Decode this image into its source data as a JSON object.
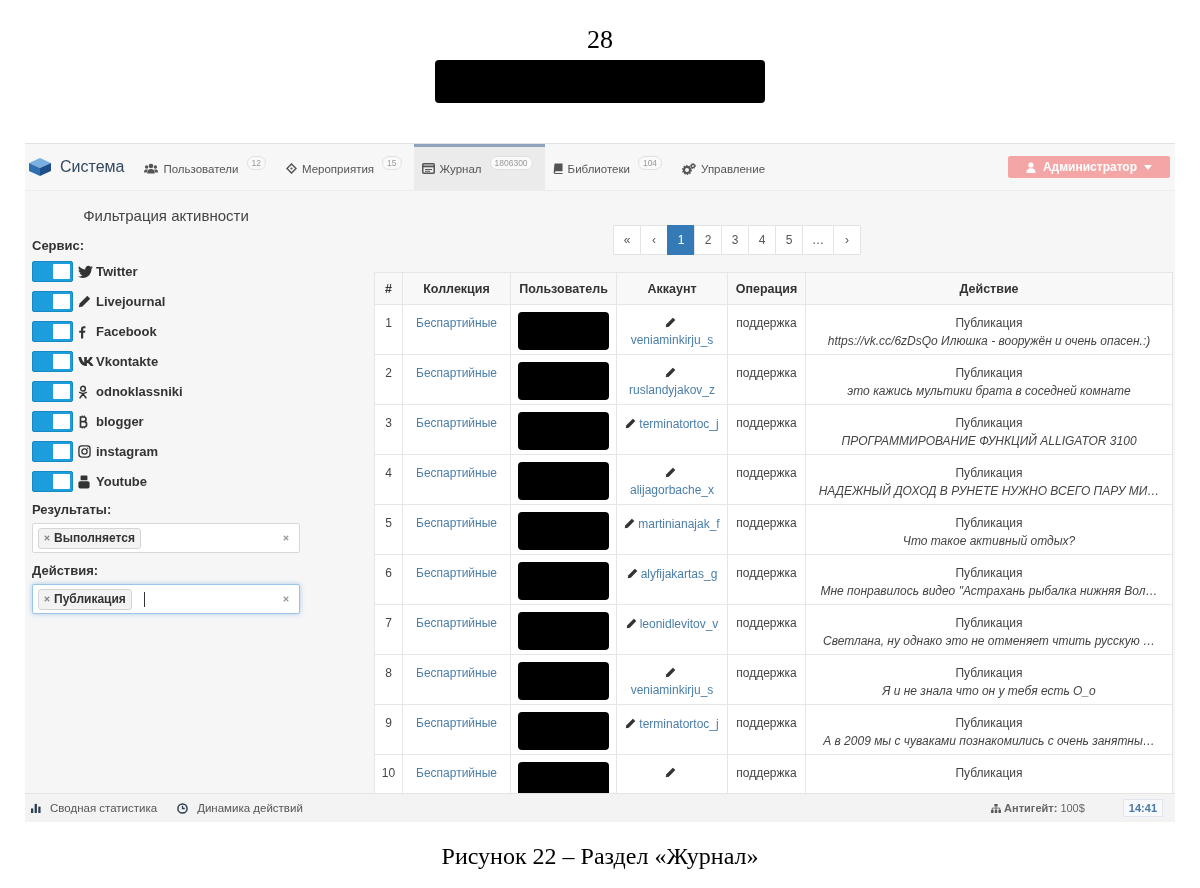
{
  "document": {
    "page_number": "28",
    "caption": "Рисунок 22 – Раздел «Журнал»"
  },
  "navbar": {
    "brand": "Система",
    "tabs": [
      {
        "label": "Пользователи",
        "count": "12",
        "selected": false
      },
      {
        "label": "Мероприятия",
        "count": "15",
        "selected": false
      },
      {
        "label": "Журнал",
        "count": "1806300",
        "selected": true
      },
      {
        "label": "Библиотеки",
        "count": "104",
        "selected": false
      },
      {
        "label": "Управление",
        "selected": false
      }
    ],
    "user_menu": "Администратор"
  },
  "sidebar": {
    "title": "Фильтрация активности",
    "services_label": "Сервис:",
    "services": [
      {
        "name": "Twitter",
        "on": true
      },
      {
        "name": "Livejournal",
        "on": true
      },
      {
        "name": "Facebook",
        "on": true
      },
      {
        "name": "Vkontakte",
        "on": true
      },
      {
        "name": "odnoklassniki",
        "on": true
      },
      {
        "name": "blogger",
        "on": true
      },
      {
        "name": "instagram",
        "on": true
      },
      {
        "name": "Youtube",
        "on": true
      }
    ],
    "filters": [
      {
        "label": "Результаты:",
        "tags": [
          "Выполняется"
        ],
        "focused": false
      },
      {
        "label": "Действия:",
        "tags": [
          "Публикация"
        ],
        "focused": true
      }
    ]
  },
  "pagination": [
    {
      "label": "«",
      "selected": false
    },
    {
      "label": "‹",
      "selected": false
    },
    {
      "label": "1",
      "selected": true
    },
    {
      "label": "2",
      "selected": false
    },
    {
      "label": "3",
      "selected": false
    },
    {
      "label": "4",
      "selected": false
    },
    {
      "label": "5",
      "selected": false
    },
    {
      "label": "…",
      "selected": false
    },
    {
      "label": "›",
      "selected": false
    }
  ],
  "table": {
    "columns": [
      "#",
      "Коллекция",
      "Пользователь",
      "Аккаунт",
      "Операция",
      "Действие"
    ],
    "rows": [
      {
        "number": "1",
        "collection": "Беспартийные",
        "account": "veniaminkirju_s",
        "operation": "поддержка",
        "action": "Публикация",
        "text": "https://vk.cc/6zDsQo Илюшка - вооружён и очень опасен.:)"
      },
      {
        "number": "2",
        "collection": "Беспартийные",
        "account": "ruslandyjakov_z",
        "operation": "поддержка",
        "action": "Публикация",
        "text": "это кажись мультики брата в соседней комнате"
      },
      {
        "number": "3",
        "collection": "Беспартийные",
        "account": "terminatortoc_j",
        "operation": "поддержка",
        "action": "Публикация",
        "text": "ПРОГРАММИРОВАНИЕ ФУНКЦИЙ ALLIGATOR 3100"
      },
      {
        "number": "4",
        "collection": "Беспартийные",
        "account": "alijagorbache_x",
        "operation": "поддержка",
        "action": "Публикация",
        "text": "НАДЕЖНЫЙ ДОХОД В РУНЕТЕ НУЖНО ВСЕГО ПАРУ МИ…"
      },
      {
        "number": "5",
        "collection": "Беспартийные",
        "account": "martinianajak_f",
        "operation": "поддержка",
        "action": "Публикация",
        "text": "Что такое активный отдых?"
      },
      {
        "number": "6",
        "collection": "Беспартийные",
        "account": "alyfijakartas_g",
        "operation": "поддержка",
        "action": "Публикация",
        "text": "Мне понравилось видео \"Астрахань рыбалка нижняя Вол…"
      },
      {
        "number": "7",
        "collection": "Беспартийные",
        "account": "leonidlevitov_v",
        "operation": "поддержка",
        "action": "Публикация",
        "text": "Светлана, ну однако это не отменяет чтить русскую …"
      },
      {
        "number": "8",
        "collection": "Беспартийные",
        "account": "veniaminkirju_s",
        "operation": "поддержка",
        "action": "Публикация",
        "text": "Я и не знала что он у тебя есть О_о"
      },
      {
        "number": "9",
        "collection": "Беспартийные",
        "account": "terminatortoc_j",
        "operation": "поддержка",
        "action": "Публикация",
        "text": "А в 2009 мы с чуваками познакомились с очень занятны…"
      },
      {
        "number": "10",
        "collection": "Беспартийные",
        "operation": "поддержка",
        "action": "Публикация"
      }
    ]
  },
  "status_bar": {
    "links": [
      "Сводная статистика",
      "Динамика действий"
    ],
    "balance": "**Антигейт:** 100$",
    "time": "14:41"
  }
}
